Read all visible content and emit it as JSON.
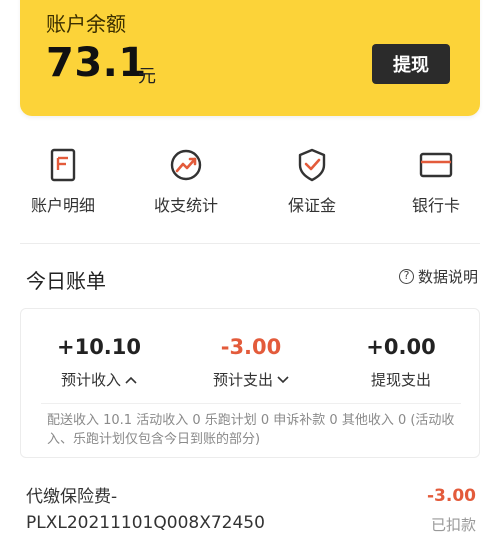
{
  "balance": {
    "label": "账户余额",
    "amount": "73.1",
    "unit": "元",
    "withdraw_label": "提现",
    "background_color": "#fcd339"
  },
  "quick_menu": [
    {
      "label": "账户明细",
      "icon": "account-detail-icon"
    },
    {
      "label": "收支统计",
      "icon": "statistics-icon"
    },
    {
      "label": "保证金",
      "icon": "deposit-shield-icon"
    },
    {
      "label": "银行卡",
      "icon": "bank-card-icon"
    }
  ],
  "today": {
    "title": "今日账单",
    "help_label": "数据说明",
    "income": {
      "value": "+10.10",
      "label": "预计收入"
    },
    "expense": {
      "value": "-3.00",
      "label": "预计支出"
    },
    "withdraw": {
      "value": "+0.00",
      "label": "提现支出"
    },
    "note": "配送收入 10.1 活动收入 0 乐跑计划 0 申诉补款 0 其他收入 0 (活动收入、乐跑计划仅包含今日到账的部分)"
  },
  "transactions": [
    {
      "title": "代缴保险费-\nPLXL20211101Q008X72450",
      "amount": "-3.00",
      "status": "已扣款"
    }
  ],
  "colors": {
    "accent": "#e35b3b",
    "dark_button": "#2b2b2b"
  }
}
